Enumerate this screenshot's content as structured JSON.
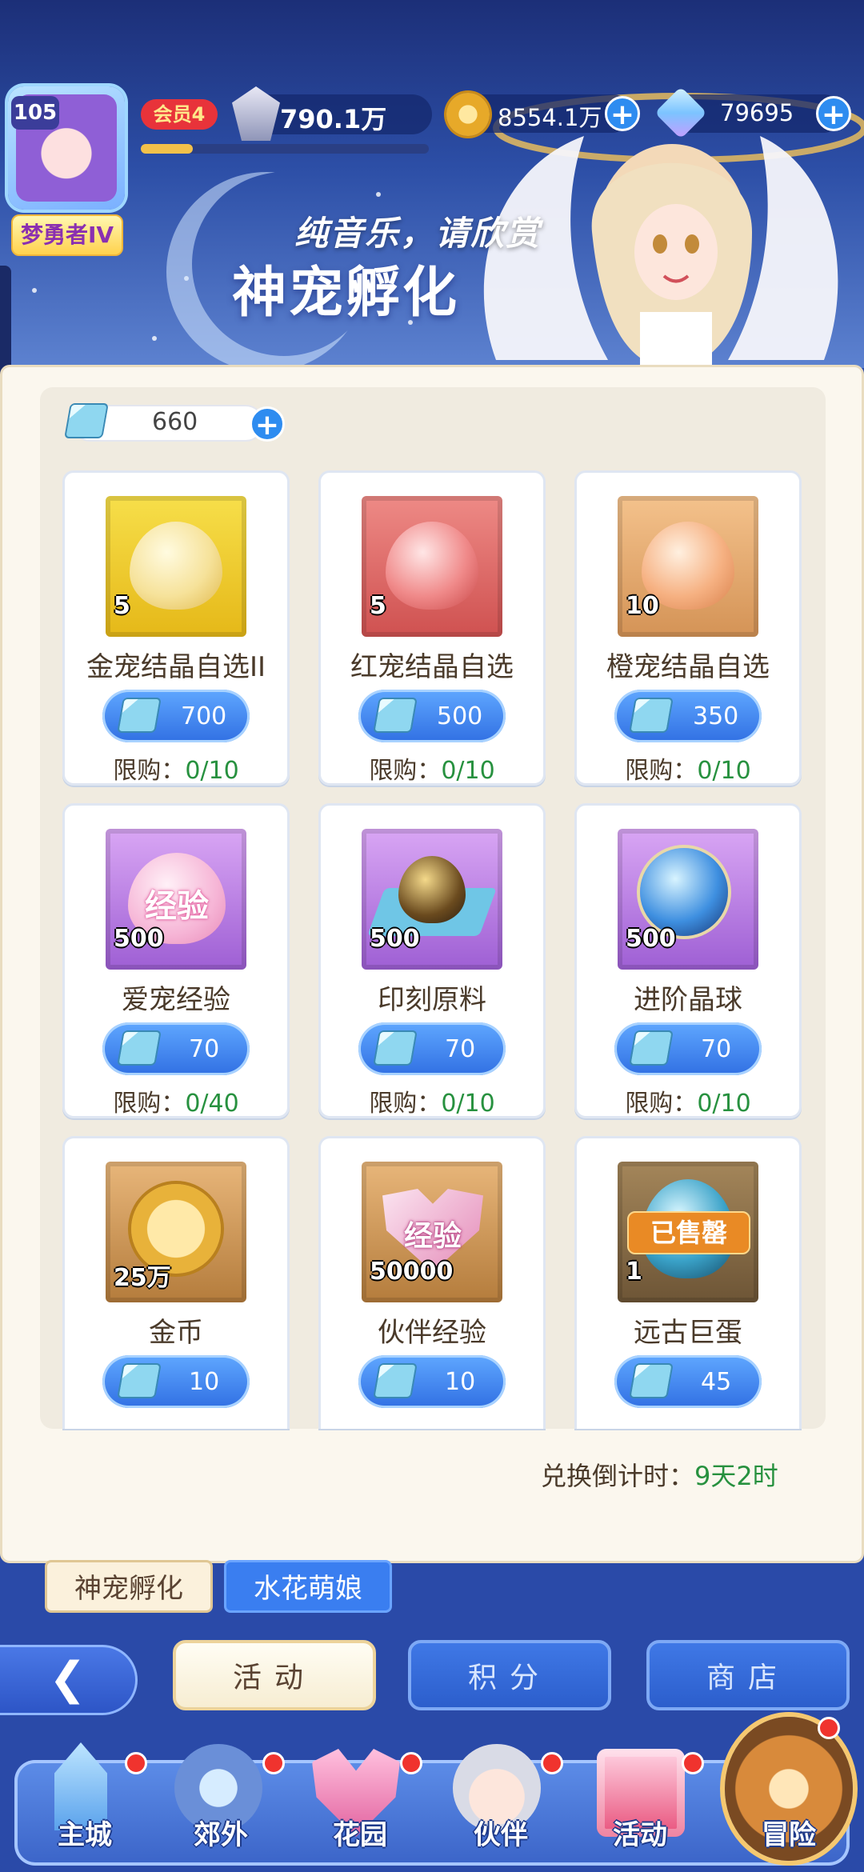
{
  "header": {
    "level": "105",
    "title_badge": "梦勇者IV",
    "vip": "会员4",
    "power": "790.1万",
    "exp_progress": 0.18,
    "coins": "8554.1万",
    "gems": "79695",
    "plus": "+"
  },
  "banner": {
    "subtitle": "纯音乐，请欣赏",
    "title": "神宠孵化"
  },
  "shop": {
    "tickets": "660",
    "items": [
      {
        "name": "金宠结晶自选II",
        "qty": "5",
        "price": "700",
        "limit_label": "限购：",
        "limit": "0/10",
        "color": "gold"
      },
      {
        "name": "红宠结晶自选",
        "qty": "5",
        "price": "500",
        "limit_label": "限购：",
        "limit": "0/10",
        "color": "red"
      },
      {
        "name": "橙宠结晶自选",
        "qty": "10",
        "price": "350",
        "limit_label": "限购：",
        "limit": "0/10",
        "color": "orange"
      },
      {
        "name": "爱宠经验",
        "qty": "500",
        "price": "70",
        "limit_label": "限购：",
        "limit": "0/40",
        "color": "purple",
        "icon_text": "经验"
      },
      {
        "name": "印刻原料",
        "qty": "500",
        "price": "70",
        "limit_label": "限购：",
        "limit": "0/10",
        "color": "purple"
      },
      {
        "name": "进阶晶球",
        "qty": "500",
        "price": "70",
        "limit_label": "限购：",
        "limit": "0/10",
        "color": "purple"
      },
      {
        "name": "金币",
        "qty": "25万",
        "price": "10",
        "color": "brown"
      },
      {
        "name": "伙伴经验",
        "qty": "50000",
        "price": "10",
        "color": "brown",
        "icon_text": "经验"
      },
      {
        "name": "远古巨蛋",
        "qty": "1",
        "price": "45",
        "color": "dark",
        "sold_label": "已售罄"
      }
    ],
    "countdown_label": "兑换倒计时：",
    "countdown_value": "9天2时"
  },
  "subtabs": [
    "神宠孵化",
    "水花萌娘"
  ],
  "main_buttons": {
    "back_icon": "back-arrow-icon",
    "activity": "活动",
    "points": "积分",
    "store": "商店"
  },
  "bottom_nav": [
    "主城",
    "郊外",
    "花园",
    "伙伴",
    "活动",
    "冒险"
  ]
}
